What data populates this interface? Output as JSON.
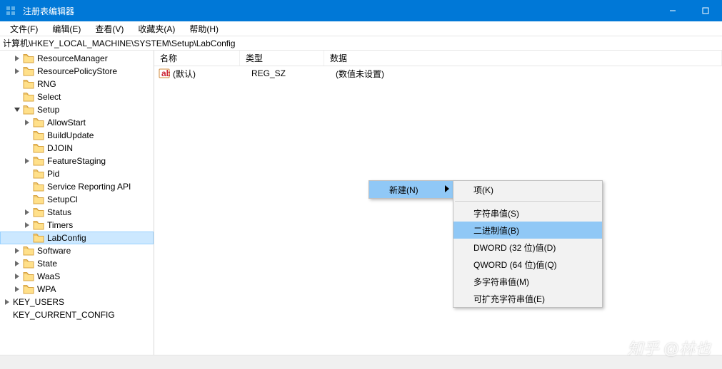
{
  "titlebar": {
    "title": "注册表编辑器"
  },
  "menu": {
    "file": "文件(F)",
    "edit": "编辑(E)",
    "view": "查看(V)",
    "fav": "收藏夹(A)",
    "help": "帮助(H)"
  },
  "address": "计算机\\HKEY_LOCAL_MACHINE\\SYSTEM\\Setup\\LabConfig",
  "columns": {
    "name": "名称",
    "type": "类型",
    "data": "数据"
  },
  "values": [
    {
      "name": "(默认)",
      "type": "REG_SZ",
      "data": "(数值未设置)"
    }
  ],
  "tree": [
    {
      "level": 1,
      "label": "ResourceManager",
      "expand": "closed"
    },
    {
      "level": 1,
      "label": "ResourcePolicyStore",
      "expand": "closed"
    },
    {
      "level": 1,
      "label": "RNG",
      "expand": "none"
    },
    {
      "level": 1,
      "label": "Select",
      "expand": "none"
    },
    {
      "level": 1,
      "label": "Setup",
      "expand": "open"
    },
    {
      "level": 2,
      "label": "AllowStart",
      "expand": "closed"
    },
    {
      "level": 2,
      "label": "BuildUpdate",
      "expand": "none"
    },
    {
      "level": 2,
      "label": "DJOIN",
      "expand": "none"
    },
    {
      "level": 2,
      "label": "FeatureStaging",
      "expand": "closed"
    },
    {
      "level": 2,
      "label": "Pid",
      "expand": "none"
    },
    {
      "level": 2,
      "label": "Service Reporting API",
      "expand": "none"
    },
    {
      "level": 2,
      "label": "SetupCl",
      "expand": "none"
    },
    {
      "level": 2,
      "label": "Status",
      "expand": "closed"
    },
    {
      "level": 2,
      "label": "Timers",
      "expand": "closed"
    },
    {
      "level": 2,
      "label": "LabConfig",
      "expand": "none",
      "selected": true
    },
    {
      "level": 1,
      "label": "Software",
      "expand": "closed"
    },
    {
      "level": 1,
      "label": "State",
      "expand": "closed"
    },
    {
      "level": 1,
      "label": "WaaS",
      "expand": "closed"
    },
    {
      "level": 1,
      "label": "WPA",
      "expand": "closed"
    },
    {
      "level": 0,
      "label": "KEY_USERS",
      "expand": "closed",
      "nofolder": true
    },
    {
      "level": 0,
      "label": "KEY_CURRENT_CONFIG",
      "expand": "none",
      "nofolder": true
    }
  ],
  "context": {
    "new": "新建(N)",
    "sub": {
      "key": "项(K)",
      "string": "字符串值(S)",
      "binary": "二进制值(B)",
      "dword": "DWORD (32 位)值(D)",
      "qword": "QWORD (64 位)值(Q)",
      "multi": "多字符串值(M)",
      "expand": "可扩充字符串值(E)"
    }
  },
  "watermark": "知乎 @林也"
}
